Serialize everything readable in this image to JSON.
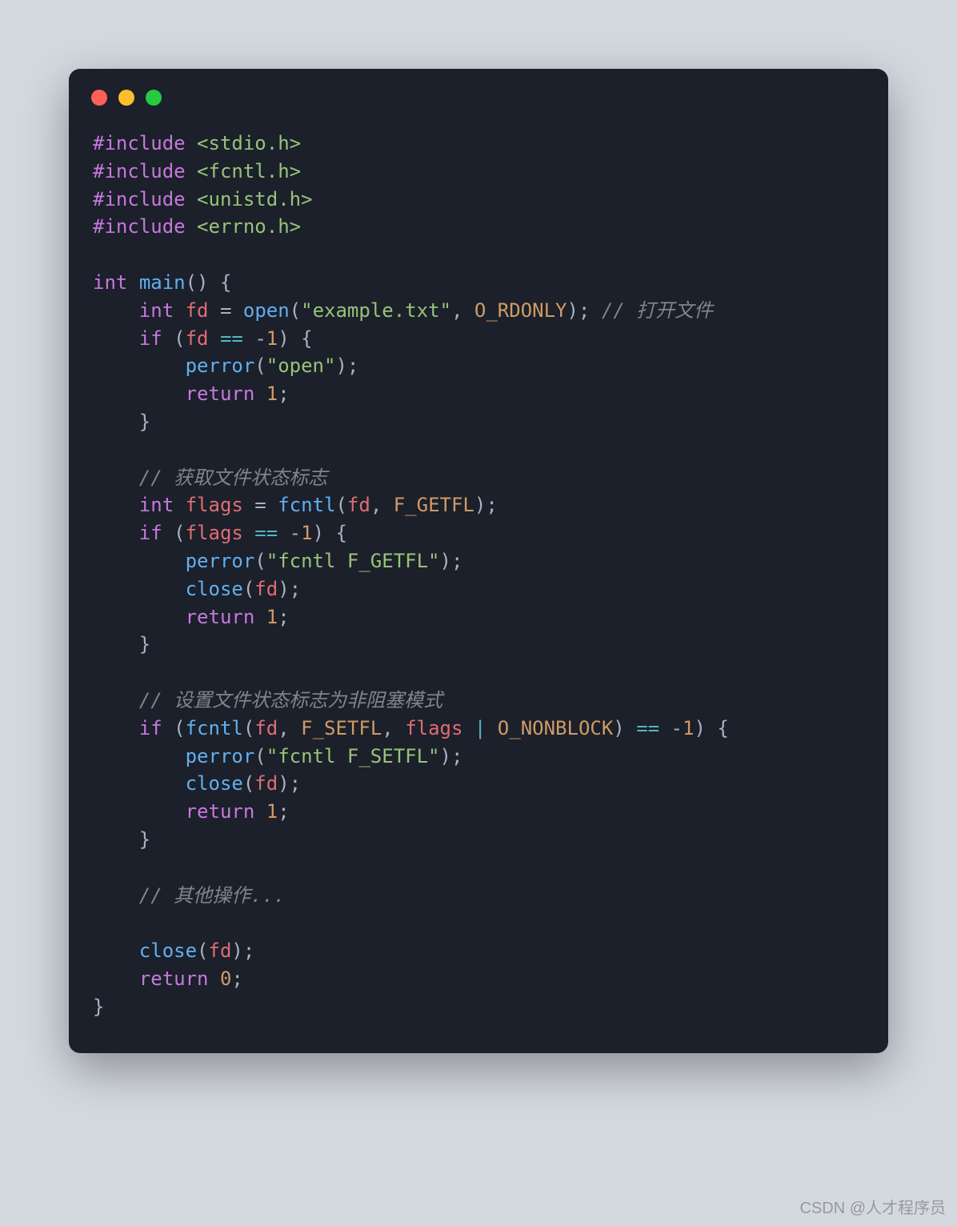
{
  "code": {
    "l1": {
      "pp": "#include",
      "inc": "<stdio.h>"
    },
    "l2": {
      "pp": "#include",
      "inc": "<fcntl.h>"
    },
    "l3": {
      "pp": "#include",
      "inc": "<unistd.h>"
    },
    "l4": {
      "pp": "#include",
      "inc": "<errno.h>"
    },
    "l6": {
      "ty": "int",
      "fn": "main",
      "tail": "() {"
    },
    "l7": {
      "ty": "int",
      "var": "fd",
      "eq": " = ",
      "fn": "open",
      "p1": "(",
      "str": "\"example.txt\"",
      "c1": ", ",
      "cst": "O_RDONLY",
      "p2": ");",
      "cm": " // 打开文件"
    },
    "l8": {
      "kw": "if",
      "p1": " (",
      "var": "fd",
      "op": " == ",
      "neg": "-",
      "num": "1",
      "p2": ") {"
    },
    "l9": {
      "fn": "perror",
      "p1": "(",
      "str": "\"open\"",
      "p2": ");"
    },
    "l10": {
      "kw": "return",
      "sp": " ",
      "num": "1",
      "p": ";"
    },
    "l11": {
      "p": "}"
    },
    "l13": {
      "cm": "// 获取文件状态标志"
    },
    "l14": {
      "ty": "int",
      "var": "flags",
      "eq": " = ",
      "fn": "fcntl",
      "p1": "(",
      "a1": "fd",
      "c1": ", ",
      "cst": "F_GETFL",
      "p2": ");"
    },
    "l15": {
      "kw": "if",
      "p1": " (",
      "var": "flags",
      "op": " == ",
      "neg": "-",
      "num": "1",
      "p2": ") {"
    },
    "l16": {
      "fn": "perror",
      "p1": "(",
      "str": "\"fcntl F_GETFL\"",
      "p2": ");"
    },
    "l17": {
      "fn": "close",
      "p1": "(",
      "a1": "fd",
      "p2": ");"
    },
    "l18": {
      "kw": "return",
      "sp": " ",
      "num": "1",
      "p": ";"
    },
    "l19": {
      "p": "}"
    },
    "l21": {
      "cm": "// 设置文件状态标志为非阻塞模式"
    },
    "l22": {
      "kw": "if",
      "p1": " (",
      "fn": "fcntl",
      "p2": "(",
      "a1": "fd",
      "c1": ", ",
      "cst1": "F_SETFL",
      "c2": ", ",
      "a2": "flags",
      "op1": " | ",
      "cst2": "O_NONBLOCK",
      "p3": ")",
      "op2": " == ",
      "neg": "-",
      "num": "1",
      "p4": ") {"
    },
    "l23": {
      "fn": "perror",
      "p1": "(",
      "str": "\"fcntl F_SETFL\"",
      "p2": ");"
    },
    "l24": {
      "fn": "close",
      "p1": "(",
      "a1": "fd",
      "p2": ");"
    },
    "l25": {
      "kw": "return",
      "sp": " ",
      "num": "1",
      "p": ";"
    },
    "l26": {
      "p": "}"
    },
    "l28": {
      "cm": "// 其他操作..."
    },
    "l30": {
      "fn": "close",
      "p1": "(",
      "a1": "fd",
      "p2": ");"
    },
    "l31": {
      "kw": "return",
      "sp": " ",
      "num": "0",
      "p": ";"
    },
    "l32": {
      "p": "}"
    }
  },
  "watermark": "CSDN @人才程序员"
}
